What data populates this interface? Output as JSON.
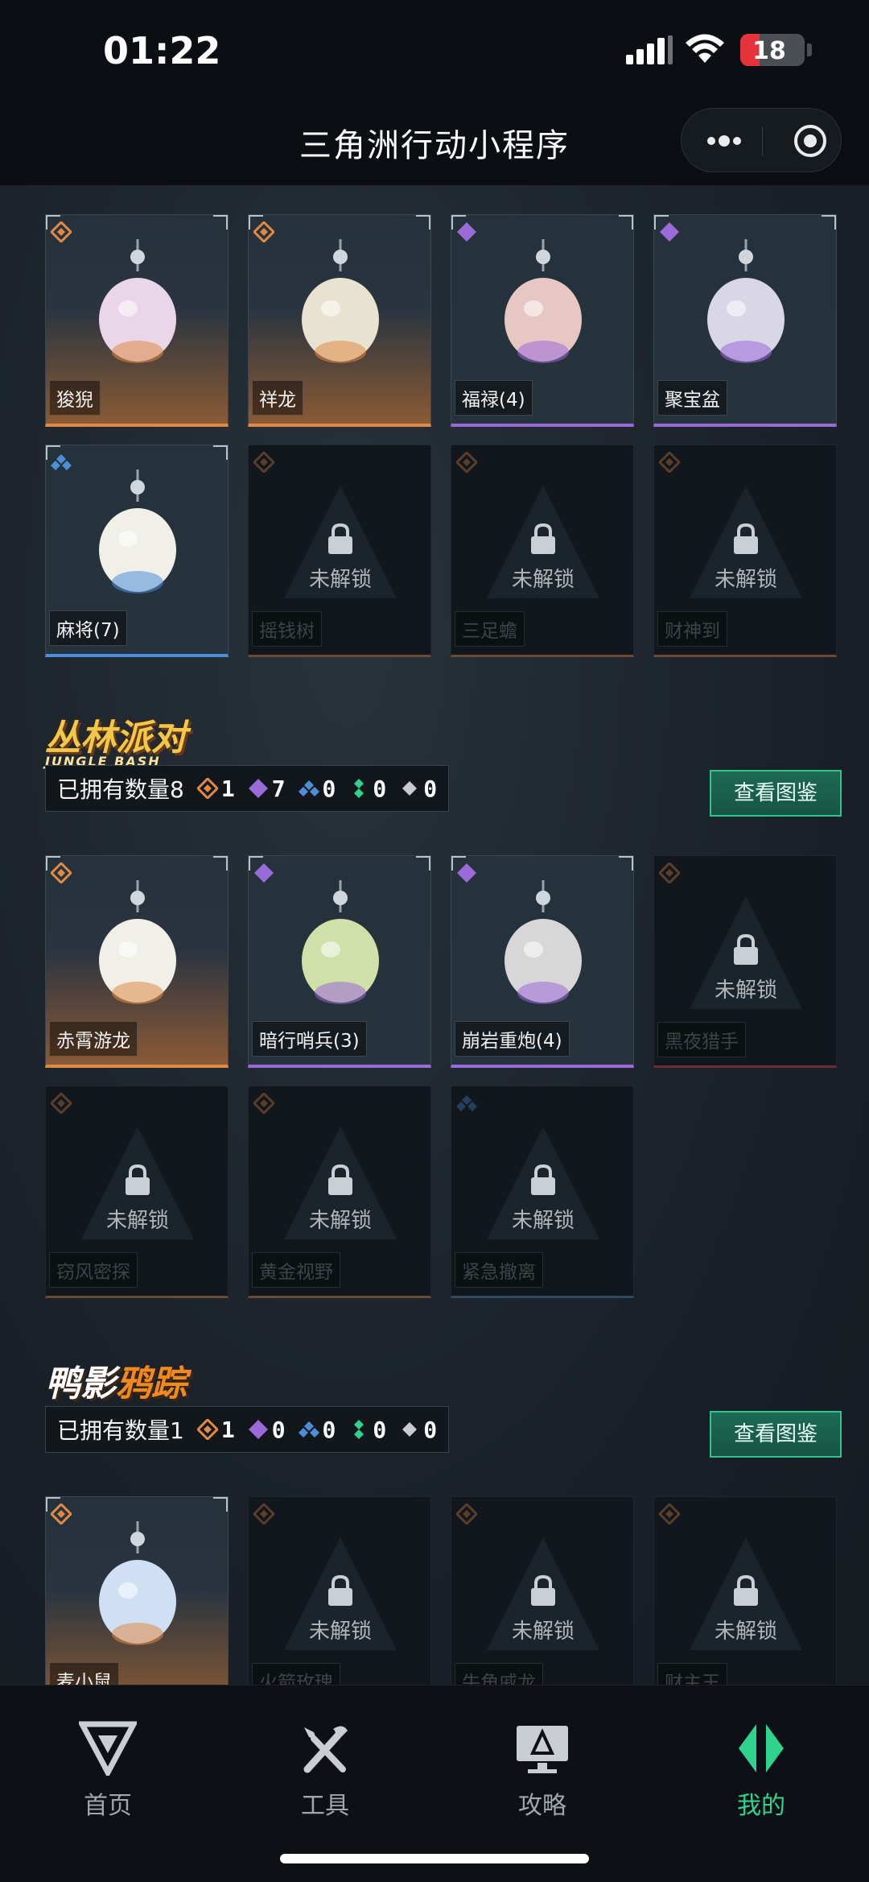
{
  "status": {
    "time": "01:22",
    "battery": "18"
  },
  "nav": {
    "title": "三角洲行动小程序"
  },
  "section0": {
    "items": [
      {
        "name": "狻猊",
        "rarity": "orange",
        "locked": false
      },
      {
        "name": "祥龙",
        "rarity": "orange",
        "locked": false
      },
      {
        "name": "福禄(4)",
        "rarity": "purple",
        "locked": false
      },
      {
        "name": "聚宝盆",
        "rarity": "purple",
        "locked": false
      },
      {
        "name": "麻将(7)",
        "rarity": "blue",
        "locked": false
      },
      {
        "name": "摇钱树",
        "rarity": "orange",
        "locked": true
      },
      {
        "name": "三足蟾",
        "rarity": "orange",
        "locked": true
      },
      {
        "name": "财神到",
        "rarity": "orange",
        "locked": true
      }
    ]
  },
  "section1": {
    "logo_main": "丛林派对",
    "logo_sub": "JUNGLE BASH",
    "owned_label": "已拥有数量8",
    "counts": {
      "orange": "1",
      "purple": "7",
      "blue": "0",
      "green": "0",
      "white": "0"
    },
    "view_button": "查看图鉴",
    "items": [
      {
        "name": "赤霄游龙",
        "rarity": "orange",
        "locked": false
      },
      {
        "name": "暗行哨兵(3)",
        "rarity": "purple",
        "locked": false
      },
      {
        "name": "崩岩重炮(4)",
        "rarity": "purple",
        "locked": false
      },
      {
        "name": "黑夜猎手",
        "rarity": "red",
        "locked": true
      },
      {
        "name": "窃风密探",
        "rarity": "orange",
        "locked": true
      },
      {
        "name": "黄金视野",
        "rarity": "orange",
        "locked": true
      },
      {
        "name": "紧急撤离",
        "rarity": "blue",
        "locked": true
      }
    ]
  },
  "section2": {
    "logo_part1": "鸭影",
    "logo_part2": "鸦踪",
    "owned_label": "已拥有数量1",
    "counts": {
      "orange": "1",
      "purple": "0",
      "blue": "0",
      "green": "0",
      "white": "0"
    },
    "view_button": "查看图鉴",
    "items": [
      {
        "name": "麦小鼠",
        "rarity": "orange",
        "locked": false
      },
      {
        "name": "火箭玫瑰",
        "rarity": "orange",
        "locked": true
      },
      {
        "name": "牛角戚龙",
        "rarity": "orange",
        "locked": true
      },
      {
        "name": "财主王",
        "rarity": "orange",
        "locked": true
      }
    ]
  },
  "locked_text": "未解锁",
  "tabs": [
    {
      "label": "首页",
      "icon": "delta-logo-icon",
      "active": false
    },
    {
      "label": "工具",
      "icon": "tools-icon",
      "active": false
    },
    {
      "label": "攻略",
      "icon": "monitor-guide-icon",
      "active": false
    },
    {
      "label": "我的",
      "icon": "profile-diamond-icon",
      "active": true
    }
  ],
  "colors": {
    "accent": "#2fd38e",
    "orange": "#e08a45",
    "purple": "#9a6ad8",
    "blue": "#4c8ed8",
    "green": "#2fd38e",
    "white": "#c8ccd0",
    "red": "#c84a4a"
  }
}
